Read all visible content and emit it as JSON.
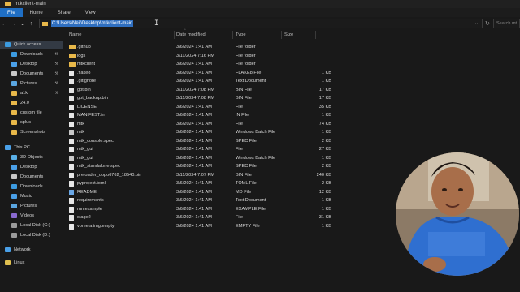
{
  "window": {
    "title": "mtkclient-main"
  },
  "ribbon": {
    "tabs": [
      "File",
      "Home",
      "Share",
      "View"
    ]
  },
  "address": {
    "path": "C:\\Users\\Neil\\Desktop\\mtkclient-main",
    "search_placeholder": "Search mt"
  },
  "columns": {
    "name": "Name",
    "date": "Date modified",
    "type": "Type",
    "size": "Size"
  },
  "sidebar": {
    "items": [
      {
        "label": "Quick access",
        "icon": "star-icon",
        "color": "#3c9be0"
      },
      {
        "label": "Downloads",
        "icon": "download-icon",
        "color": "#3c9be0",
        "pinned": true
      },
      {
        "label": "Desktop",
        "icon": "desktop-icon",
        "color": "#4aa0e8",
        "pinned": true
      },
      {
        "label": "Documents",
        "icon": "documents-icon",
        "color": "#c8c8c8",
        "pinned": true
      },
      {
        "label": "Pictures",
        "icon": "pictures-icon",
        "color": "#5aa6e0",
        "pinned": true
      },
      {
        "label": "a1k",
        "icon": "folder-icon",
        "color": "#e8b84a",
        "pinned": true
      },
      {
        "label": "24.0",
        "icon": "folder-icon",
        "color": "#e8b84a"
      },
      {
        "label": "custom file",
        "icon": "folder-icon",
        "color": "#e8b84a"
      },
      {
        "label": "splus",
        "icon": "folder-icon",
        "color": "#e8b84a"
      },
      {
        "label": "Screenshots",
        "icon": "folder-icon",
        "color": "#e8b84a"
      },
      {
        "label": "This PC",
        "icon": "pc-icon",
        "color": "#4aa0e8"
      },
      {
        "label": "3D Objects",
        "icon": "cube-icon",
        "color": "#5ab0e8"
      },
      {
        "label": "Desktop",
        "icon": "desktop-icon",
        "color": "#4aa0e8"
      },
      {
        "label": "Documents",
        "icon": "documents-icon",
        "color": "#c8c8c8"
      },
      {
        "label": "Downloads",
        "icon": "download-icon",
        "color": "#3c9be0"
      },
      {
        "label": "Music",
        "icon": "music-icon",
        "color": "#4aa0e8"
      },
      {
        "label": "Pictures",
        "icon": "pictures-icon",
        "color": "#5aa6e0"
      },
      {
        "label": "Videos",
        "icon": "videos-icon",
        "color": "#8a6ad0"
      },
      {
        "label": "Local Disk (C:)",
        "icon": "drive-icon",
        "color": "#9a9a9a"
      },
      {
        "label": "Local Disk (D:)",
        "icon": "drive-icon",
        "color": "#9a9a9a"
      },
      {
        "label": "Network",
        "icon": "network-icon",
        "color": "#4aa0e8"
      },
      {
        "label": "Linux",
        "icon": "penguin-icon",
        "color": "#e0c050"
      }
    ]
  },
  "files": [
    {
      "name": ".github",
      "date": "3/6/2024 1:41 AM",
      "type": "File folder",
      "size": "",
      "kind": "folder"
    },
    {
      "name": "logs",
      "date": "3/11/2024 7:16 PM",
      "type": "File folder",
      "size": "",
      "kind": "folder"
    },
    {
      "name": "mtkclient",
      "date": "3/6/2024 1:41 AM",
      "type": "File folder",
      "size": "",
      "kind": "folder"
    },
    {
      "name": ".flake8",
      "date": "3/6/2024 1:41 AM",
      "type": "FLAKE8 File",
      "size": "1 KB",
      "kind": "file"
    },
    {
      "name": ".gitignore",
      "date": "3/6/2024 1:41 AM",
      "type": "Text Document",
      "size": "1 KB",
      "kind": "file"
    },
    {
      "name": "gpt.bin",
      "date": "3/11/2024 7:08 PM",
      "type": "BIN File",
      "size": "17 KB",
      "kind": "file"
    },
    {
      "name": "gpt_backup.bin",
      "date": "3/11/2024 7:08 PM",
      "type": "BIN File",
      "size": "17 KB",
      "kind": "file"
    },
    {
      "name": "LICENSE",
      "date": "3/6/2024 1:41 AM",
      "type": "File",
      "size": "35 KB",
      "kind": "file"
    },
    {
      "name": "MANIFEST.in",
      "date": "3/6/2024 1:41 AM",
      "type": "IN File",
      "size": "1 KB",
      "kind": "file"
    },
    {
      "name": "mtk",
      "date": "3/6/2024 1:41 AM",
      "type": "File",
      "size": "74 KB",
      "kind": "file"
    },
    {
      "name": "mtk",
      "date": "3/6/2024 1:41 AM",
      "type": "Windows Batch File",
      "size": "1 KB",
      "kind": "batch"
    },
    {
      "name": "mtk_console.spec",
      "date": "3/6/2024 1:41 AM",
      "type": "SPEC File",
      "size": "2 KB",
      "kind": "file"
    },
    {
      "name": "mtk_gui",
      "date": "3/6/2024 1:41 AM",
      "type": "File",
      "size": "27 KB",
      "kind": "file"
    },
    {
      "name": "mtk_gui",
      "date": "3/6/2024 1:41 AM",
      "type": "Windows Batch File",
      "size": "1 KB",
      "kind": "batch"
    },
    {
      "name": "mtk_standalone.spec",
      "date": "3/6/2024 1:41 AM",
      "type": "SPEC File",
      "size": "2 KB",
      "kind": "file"
    },
    {
      "name": "preloader_oppo6762_18540.bin",
      "date": "3/11/2024 7:07 PM",
      "type": "BIN File",
      "size": "240 KB",
      "kind": "file"
    },
    {
      "name": "pyproject.toml",
      "date": "3/6/2024 1:41 AM",
      "type": "TOML File",
      "size": "2 KB",
      "kind": "file"
    },
    {
      "name": "README",
      "date": "3/6/2024 1:41 AM",
      "type": "MD File",
      "size": "12 KB",
      "kind": "md"
    },
    {
      "name": "requirements",
      "date": "3/6/2024 1:41 AM",
      "type": "Text Document",
      "size": "1 KB",
      "kind": "file"
    },
    {
      "name": "run.example",
      "date": "3/6/2024 1:41 AM",
      "type": "EXAMPLE File",
      "size": "1 KB",
      "kind": "file"
    },
    {
      "name": "stage2",
      "date": "3/6/2024 1:41 AM",
      "type": "File",
      "size": "31 KB",
      "kind": "file"
    },
    {
      "name": "vbmeta.img.empty",
      "date": "3/6/2024 1:41 AM",
      "type": "EMPTY File",
      "size": "1 KB",
      "kind": "file"
    }
  ]
}
